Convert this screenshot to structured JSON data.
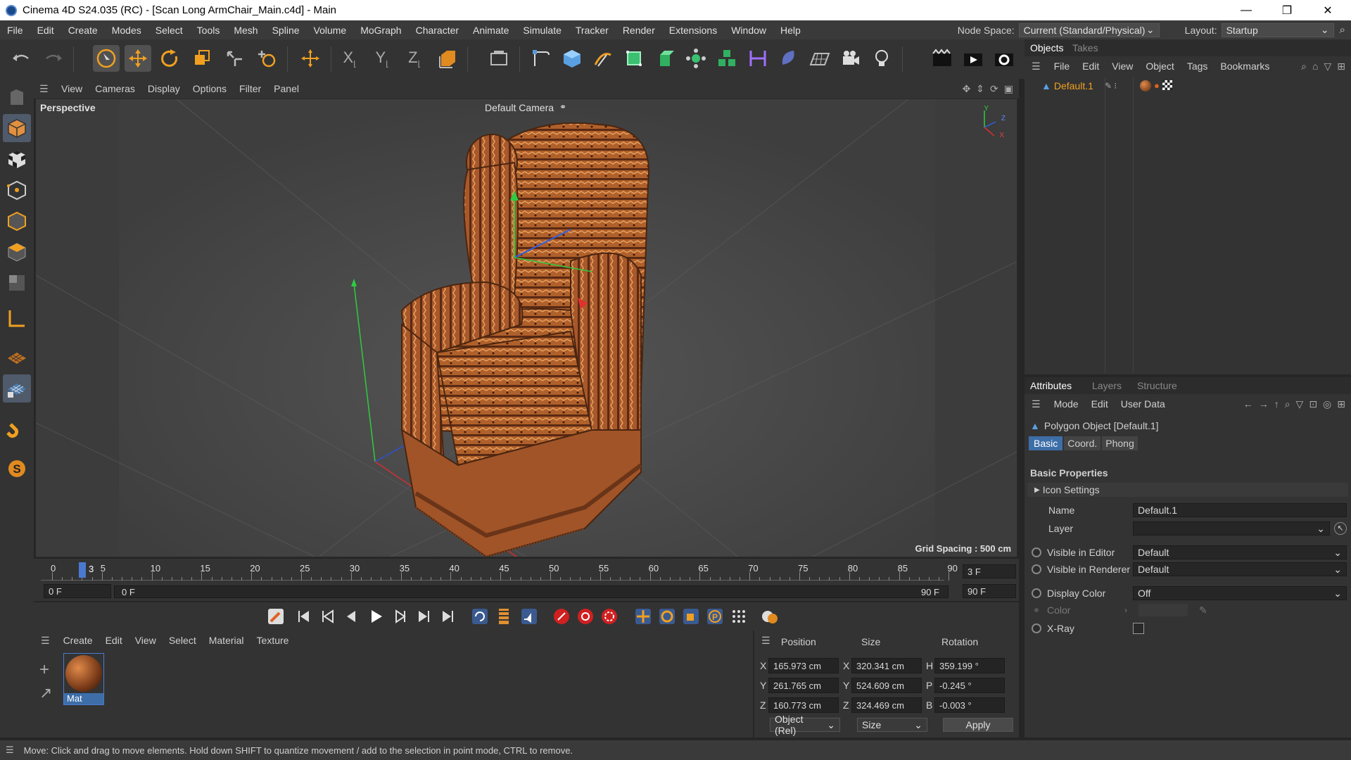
{
  "window": {
    "title": "Cinema 4D S24.035 (RC) - [Scan Long ArmChair_Main.c4d] - Main",
    "minimize": "—",
    "maximize": "❐",
    "close": "✕"
  },
  "menu": [
    "File",
    "Edit",
    "Create",
    "Modes",
    "Select",
    "Tools",
    "Mesh",
    "Spline",
    "Volume",
    "MoGraph",
    "Character",
    "Animate",
    "Simulate",
    "Tracker",
    "Render",
    "Extensions",
    "Window",
    "Help"
  ],
  "node_space": {
    "label": "Node Space:",
    "value": "Current (Standard/Physical)"
  },
  "layout": {
    "label": "Layout:",
    "value": "Startup"
  },
  "viewport": {
    "menu": [
      "View",
      "Cameras",
      "Display",
      "Options",
      "Filter",
      "Panel"
    ],
    "name": "Perspective",
    "camera": "Default Camera",
    "grid_spacing": "Grid Spacing : 500 cm",
    "axis_y": "Y",
    "axis_z": "Z",
    "axis_x": "X"
  },
  "timeline": {
    "ticks": [
      "0",
      "5",
      "10",
      "15",
      "20",
      "25",
      "30",
      "35",
      "40",
      "45",
      "50",
      "55",
      "60",
      "65",
      "70",
      "75",
      "80",
      "85",
      "90"
    ],
    "current_marker": "3",
    "current_frame": "3 F",
    "start": "0 F",
    "range_start": "0 F",
    "range_end": "90 F",
    "end": "90 F"
  },
  "material_manager": {
    "menu": [
      "Create",
      "Edit",
      "View",
      "Select",
      "Material",
      "Texture"
    ],
    "material_name": "Mat"
  },
  "coordinates": {
    "headers": {
      "position": "Position",
      "size": "Size",
      "rotation": "Rotation"
    },
    "pos": {
      "x": "165.973 cm",
      "y": "261.765 cm",
      "z": "160.773 cm"
    },
    "size": {
      "x": "320.341 cm",
      "y": "524.609 cm",
      "z": "324.469 cm"
    },
    "rot": {
      "h": "359.199 °",
      "p": "-0.245 °",
      "b": "-0.003 °"
    },
    "labels": {
      "x": "X",
      "y": "Y",
      "z": "Z",
      "h": "H",
      "p": "P",
      "b": "B"
    },
    "mode": "Object (Rel)",
    "size_mode": "Size",
    "apply": "Apply"
  },
  "objects_panel": {
    "tabs": [
      "Objects",
      "Takes"
    ],
    "menu": [
      "File",
      "Edit",
      "View",
      "Object",
      "Tags",
      "Bookmarks"
    ],
    "object_name": "Default.1"
  },
  "attributes_panel": {
    "tabs": [
      "Attributes",
      "Layers",
      "Structure"
    ],
    "menu": [
      "Mode",
      "Edit",
      "User Data"
    ],
    "object_title": "Polygon Object [Default.1]",
    "subtabs": [
      "Basic",
      "Coord.",
      "Phong"
    ],
    "section": "Basic Properties",
    "icon_settings": "Icon Settings",
    "name_label": "Name",
    "name_value": "Default.1",
    "layer_label": "Layer",
    "visible_editor_label": "Visible in Editor",
    "visible_editor_value": "Default",
    "visible_renderer_label": "Visible in Renderer",
    "visible_renderer_value": "Default",
    "display_color_label": "Display Color",
    "display_color_value": "Off",
    "color_label": "Color",
    "xray_label": "X-Ray"
  },
  "status": "Move: Click and drag to move elements. Hold down SHIFT to quantize movement / add to the selection in point mode, CTRL to remove.",
  "colors": {
    "accent_orange": "#f0a020",
    "accent_blue": "#4a8ad0",
    "selected_tab": "#3d6ea8"
  }
}
